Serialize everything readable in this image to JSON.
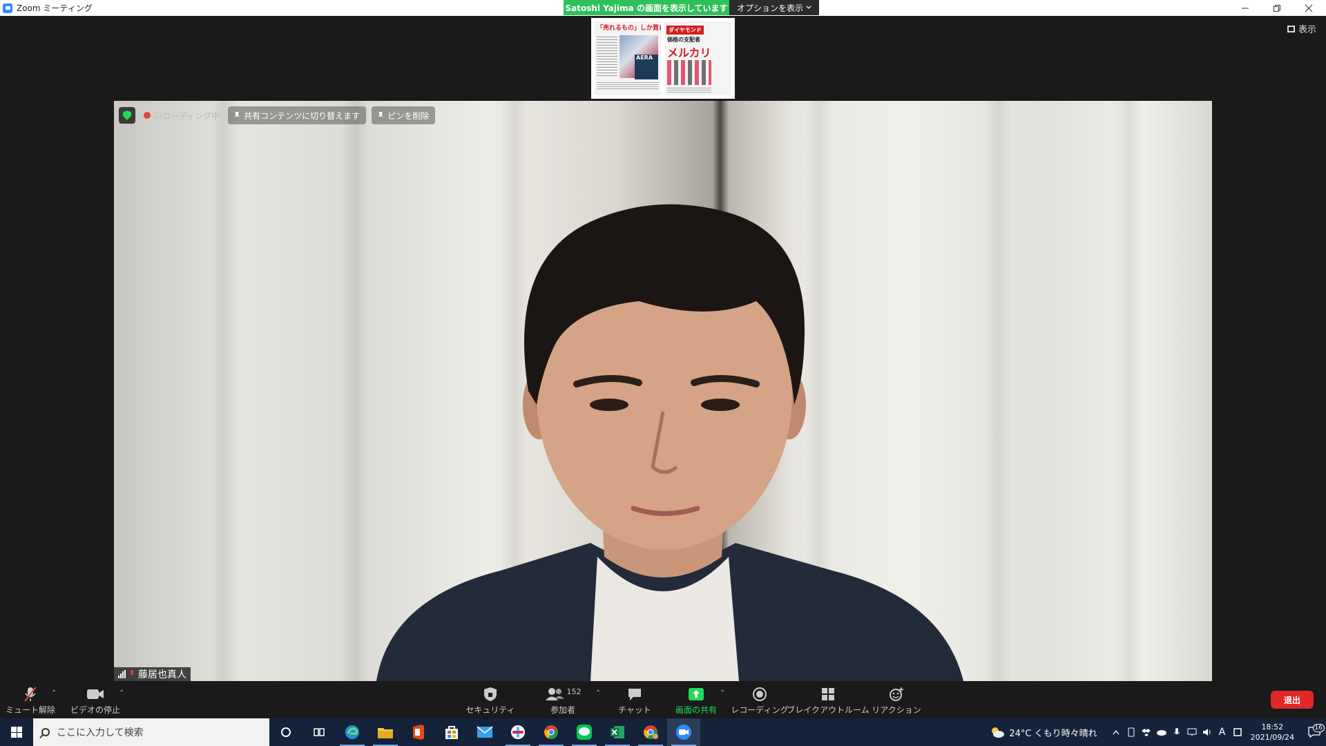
{
  "window": {
    "title": "Zoom ミーティング"
  },
  "share": {
    "banner": "Satoshi  Yajima の画面を表示しています",
    "options_label": "オプションを表示"
  },
  "view": {
    "label": "表示"
  },
  "thumbnail": {
    "page1_headline": "「売れるもの」しか買わない",
    "page1_logo": "AERA",
    "page2_masthead": "ダイヤモンド",
    "page2_subtitle": "価格の支配者",
    "page2_big": "メルカリ"
  },
  "video_controls": {
    "recording_label": "レコーディング中",
    "switch_content_label": "共有コンテンツに切り替えます",
    "unpin_label": "ピンを削除"
  },
  "participant": {
    "name": "藤居也真人"
  },
  "toolbar": {
    "unmute": "ミュート解除",
    "stop_video": "ビデオの停止",
    "security": "セキュリティ",
    "participants": "参加者",
    "participants_count": "152",
    "chat": "チャット",
    "share_screen": "画面の共有",
    "record": "レコーディング",
    "breakout": "ブレイクアウトルーム",
    "reactions": "リアクション",
    "leave": "退出"
  },
  "taskbar": {
    "search_placeholder": "ここに入力して検索",
    "weather": "24°C  くもり時々晴れ",
    "ime": "A",
    "time": "18:52",
    "date": "2021/09/24",
    "notification_count": "16"
  },
  "colors": {
    "zoom_blue": "#2d8cff",
    "share_green": "#2ec05a",
    "leave_red": "#e02828",
    "taskbar": "#14233a"
  }
}
